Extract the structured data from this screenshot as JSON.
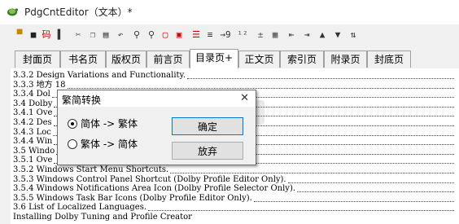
{
  "window": {
    "title": "PdgCntEditor（文本）*"
  },
  "toolbar": {
    "items": [
      {
        "icon": "open-folder-icon",
        "glyph": "▀"
      },
      {
        "icon": "save-icon",
        "glyph": "■"
      },
      {
        "icon": "code-icon",
        "glyph": "码"
      },
      {
        "icon": "bookmark-icon",
        "glyph": "▌"
      },
      {
        "icon": "cut-icon",
        "glyph": "✂"
      },
      {
        "icon": "copy-icon",
        "glyph": "❐"
      },
      {
        "icon": "paste-icon",
        "glyph": "▤"
      },
      {
        "icon": "undo-icon",
        "glyph": "↶"
      },
      {
        "icon": "find-icon",
        "glyph": "⚲"
      },
      {
        "icon": "find-replace-icon",
        "glyph": "⚲"
      },
      {
        "icon": "insert-page-icon",
        "glyph": "▢"
      },
      {
        "icon": "page-tool-icon",
        "glyph": "▣"
      },
      {
        "icon": "align-red-icon",
        "glyph": "☰"
      },
      {
        "icon": "indent-icon",
        "glyph": "≡"
      },
      {
        "icon": "jump-9-icon",
        "glyph": "→9"
      },
      {
        "icon": "number-icon",
        "glyph": "¹²"
      },
      {
        "icon": "plus-minus-icon",
        "glyph": "±"
      },
      {
        "icon": "grid-icon",
        "glyph": "▦"
      },
      {
        "icon": "outdent-icon",
        "glyph": "⇤"
      },
      {
        "icon": "indent-more-icon",
        "glyph": "⇥"
      },
      {
        "icon": "arrow-up-icon",
        "glyph": "▲"
      },
      {
        "icon": "arrow-down-icon",
        "glyph": "▼"
      },
      {
        "icon": "sort-icon",
        "glyph": "⇅"
      }
    ]
  },
  "tabs": [
    {
      "label": "封面页"
    },
    {
      "label": "书名页"
    },
    {
      "label": "版权页"
    },
    {
      "label": "前言页"
    },
    {
      "label": "目录页+"
    },
    {
      "label": "正文页"
    },
    {
      "label": "索引页"
    },
    {
      "label": "附录页"
    },
    {
      "label": "封底页"
    }
  ],
  "editor": {
    "lines": [
      {
        "text": "3.3.2 Design Variations and Functionality."
      },
      {
        "text": "3.3.3 地方         18"
      },
      {
        "text": "3.3.4 Dol"
      },
      {
        "text": "3.4 Dolby"
      },
      {
        "text": "3.4.1 Ove"
      },
      {
        "text": "3.4.2 Des"
      },
      {
        "text": "3.4.3 Loc"
      },
      {
        "text": "3.4.4 Win"
      },
      {
        "text": "3.5 Windo"
      },
      {
        "text": "3.5.1 Ove"
      },
      {
        "text": "3.5.2 Windows Start Menu Shortcuts."
      },
      {
        "text": "3.5.3 Windows Control Panel Shortcut (Dolby Profile Editor Only)."
      },
      {
        "text": "3.5.4 Windows Notifications Area Icon (Dolby Profile Selector Only)."
      },
      {
        "text": "3.5.5 Windows Task Bar Icons (Dolby Profile Editor Only)."
      },
      {
        "text": "3.6 List of Localized Languages."
      },
      {
        "text": "Installing Dolby Tuning and Profile Creator"
      }
    ]
  },
  "dialog": {
    "title": "繁简转换",
    "close": "✕",
    "options": [
      {
        "label": "简体 -> 繁体",
        "selected": true
      },
      {
        "label": "繁体 -> 简体",
        "selected": false
      }
    ],
    "ok_label": "确定",
    "cancel_label": "放弃"
  }
}
